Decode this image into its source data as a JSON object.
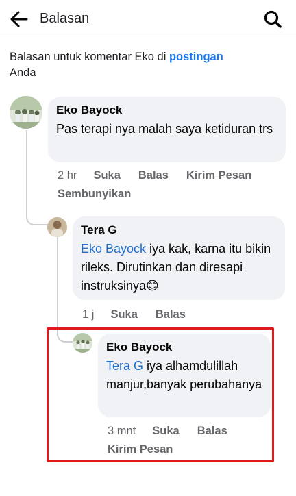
{
  "header": {
    "title": "Balasan",
    "back_icon": "arrow-left-icon",
    "search_icon": "search-icon"
  },
  "subtitle": {
    "prefix": "Balasan untuk komentar Eko di ",
    "link": "postingan",
    "suffix": "Anda"
  },
  "comments": [
    {
      "author": "Eko Bayock",
      "text": "Pas terapi nya malah saya ketiduran trs",
      "time": "2 hr",
      "actions": [
        "Suka",
        "Balas",
        "Kirim Pesan",
        "Sembunyikan"
      ]
    },
    {
      "author": "Tera G",
      "mention": "Eko Bayock",
      "text": " iya kak, karna itu bikin rileks. Dirutinkan dan diresapi instruksinya😊",
      "time": "1 j",
      "actions": [
        "Suka",
        "Balas"
      ]
    },
    {
      "author": "Eko Bayock",
      "mention": "Tera G",
      "text": " iya alhamdulillah manjur,banyak perubahanya",
      "time": "3 mnt",
      "actions": [
        "Suka",
        "Balas",
        "Kirim Pesan"
      ]
    }
  ],
  "colors": {
    "link": "#1877f2",
    "mention": "#1f6fd1",
    "bubble": "#f0f2f5",
    "highlight": "#e0191b",
    "meta": "#65676b"
  }
}
